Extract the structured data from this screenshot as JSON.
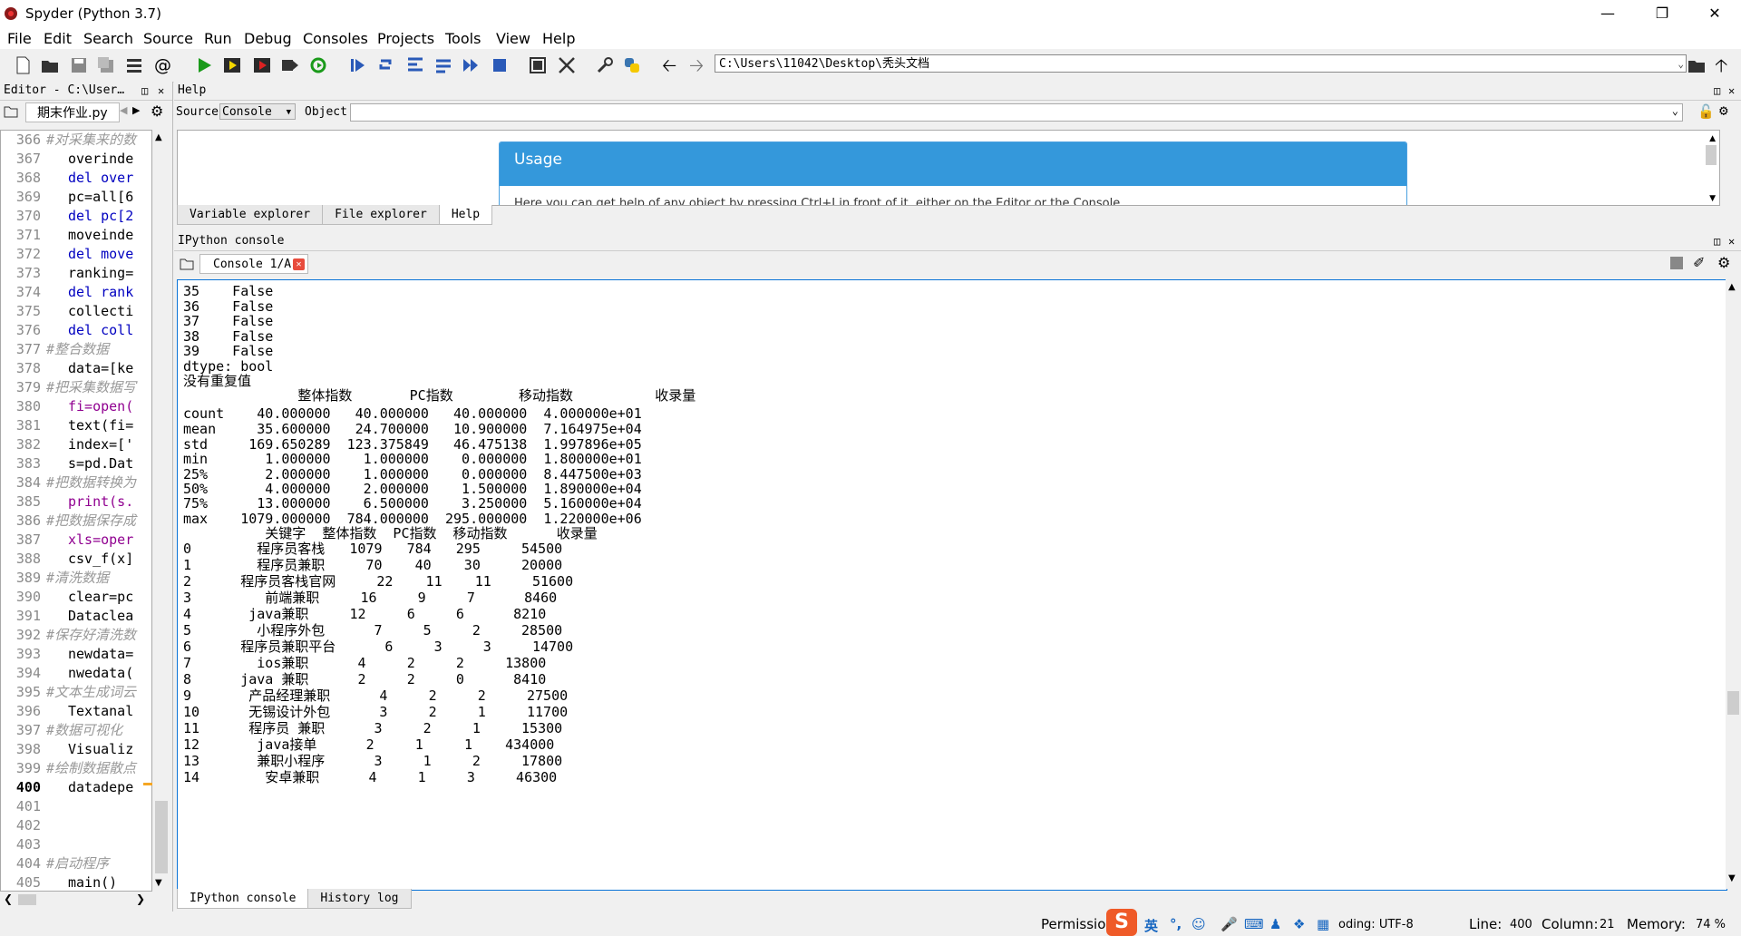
{
  "window": {
    "title": "Spyder (Python 3.7)"
  },
  "menu": [
    "File",
    "Edit",
    "Search",
    "Source",
    "Run",
    "Debug",
    "Consoles",
    "Projects",
    "Tools",
    "View",
    "Help"
  ],
  "toolbar": {
    "path": "C:\\Users\\11042\\Desktop\\秃头文档"
  },
  "editor": {
    "header": "Editor - C:\\User…",
    "tab": "期末作业.py",
    "lines": [
      {
        "n": "366",
        "t": "#对采集来的数",
        "c": "cmt"
      },
      {
        "n": "367",
        "t": "overinde",
        "c": ""
      },
      {
        "n": "368",
        "t": "del over",
        "c": "kw"
      },
      {
        "n": "369",
        "t": "pc=all[6",
        "c": ""
      },
      {
        "n": "370",
        "t": "del pc[2",
        "c": "kw"
      },
      {
        "n": "371",
        "t": "moveinde",
        "c": ""
      },
      {
        "n": "372",
        "t": "del move",
        "c": "kw"
      },
      {
        "n": "373",
        "t": "ranking=",
        "c": ""
      },
      {
        "n": "374",
        "t": "del rank",
        "c": "kw"
      },
      {
        "n": "375",
        "t": "collecti",
        "c": ""
      },
      {
        "n": "376",
        "t": "del coll",
        "c": "kw"
      },
      {
        "n": "377",
        "t": "#整合数据",
        "c": "cmt"
      },
      {
        "n": "378",
        "t": "data=[ke",
        "c": ""
      },
      {
        "n": "379",
        "t": "#把采集数据写",
        "c": "cmt"
      },
      {
        "n": "380",
        "t": "fi=open(",
        "c": "fn"
      },
      {
        "n": "381",
        "t": "text(fi=",
        "c": ""
      },
      {
        "n": "382",
        "t": "index=['",
        "c": ""
      },
      {
        "n": "383",
        "t": "s=pd.Dat",
        "c": ""
      },
      {
        "n": "384",
        "t": "#把数据转换为",
        "c": "cmt"
      },
      {
        "n": "385",
        "t": "print(s.",
        "c": "fn"
      },
      {
        "n": "386",
        "t": "#把数据保存成",
        "c": "cmt"
      },
      {
        "n": "387",
        "t": "xls=oper",
        "c": "fn"
      },
      {
        "n": "388",
        "t": "csv_f(x]",
        "c": ""
      },
      {
        "n": "389",
        "t": "#清洗数据",
        "c": "cmt"
      },
      {
        "n": "390",
        "t": "clear=pc",
        "c": ""
      },
      {
        "n": "391",
        "t": "Dataclea",
        "c": ""
      },
      {
        "n": "392",
        "t": "#保存好清洗数",
        "c": "cmt"
      },
      {
        "n": "393",
        "t": "newdata=",
        "c": ""
      },
      {
        "n": "394",
        "t": "nwedata(",
        "c": ""
      },
      {
        "n": "395",
        "t": "#文本生成词云",
        "c": "cmt"
      },
      {
        "n": "396",
        "t": "Textanal",
        "c": ""
      },
      {
        "n": "397",
        "t": "#数据可视化",
        "c": "cmt"
      },
      {
        "n": "398",
        "t": "Visualiz",
        "c": ""
      },
      {
        "n": "399",
        "t": "#绘制数据散点",
        "c": "cmt"
      },
      {
        "n": "400",
        "t": "datadepe",
        "c": ""
      },
      {
        "n": "401",
        "t": "",
        "c": ""
      },
      {
        "n": "402",
        "t": "",
        "c": ""
      },
      {
        "n": "403",
        "t": "",
        "c": ""
      },
      {
        "n": "404",
        "t": "#启动程序",
        "c": "cmt"
      },
      {
        "n": "405",
        "t": "main()",
        "c": ""
      }
    ]
  },
  "help": {
    "header": "Help",
    "source_label": "Source",
    "source_value": "Console",
    "object_label": "Object",
    "usage_title": "Usage",
    "usage_text": "Here you can get help of any object by pressing Ctrl+I in front of it, either on the Editor or the Console.",
    "tabs": [
      "Variable explorer",
      "File explorer",
      "Help"
    ]
  },
  "console": {
    "header": "IPython console",
    "tab": "Console 1/A",
    "lines": [
      "35    False",
      "36    False",
      "37    False",
      "38    False",
      "39    False",
      "dtype: bool",
      "没有重复值",
      "              整体指数       PC指数        移动指数          收录量",
      "count    40.000000   40.000000   40.000000  4.000000e+01",
      "mean     35.600000   24.700000   10.900000  7.164975e+04",
      "std     169.650289  123.375849   46.475138  1.997896e+05",
      "min       1.000000    1.000000    0.000000  1.800000e+01",
      "25%       2.000000    1.000000    0.000000  8.447500e+03",
      "50%       4.000000    2.000000    1.500000  1.890000e+04",
      "75%      13.000000    6.500000    3.250000  5.160000e+04",
      "max    1079.000000  784.000000  295.000000  1.220000e+06",
      "          关键字  整体指数  PC指数  移动指数      收录量",
      "0        程序员客栈   1079   784   295     54500",
      "1        程序员兼职     70    40    30     20000",
      "2      程序员客栈官网     22    11    11     51600",
      "3         前端兼职     16     9     7      8460",
      "4       java兼职     12     6     6      8210",
      "5        小程序外包      7     5     2     28500",
      "6      程序员兼职平台      6     3     3     14700",
      "7        ios兼职      4     2     2     13800",
      "8      java 兼职      2     2     0      8410",
      "9       产品经理兼职      4     2     2     27500",
      "10      无锡设计外包      3     2     1     11700",
      "11      程序员 兼职      3     2     1     15300",
      "12       java接单      2     1     1    434000",
      "13       兼职小程序      3     1     2     17800",
      "14        安卓兼职      4     1     3     46300"
    ],
    "bottom_tabs": [
      "IPython console",
      "History log"
    ]
  },
  "status": {
    "permissions": "Permissions",
    "ime_lang": "英",
    "encoding": "oding: UTF-8",
    "line_label": "Line:",
    "line_value": "400",
    "column_label": "Column:",
    "column_value": "21",
    "memory_label": "Memory:",
    "memory_value": "74 %"
  }
}
